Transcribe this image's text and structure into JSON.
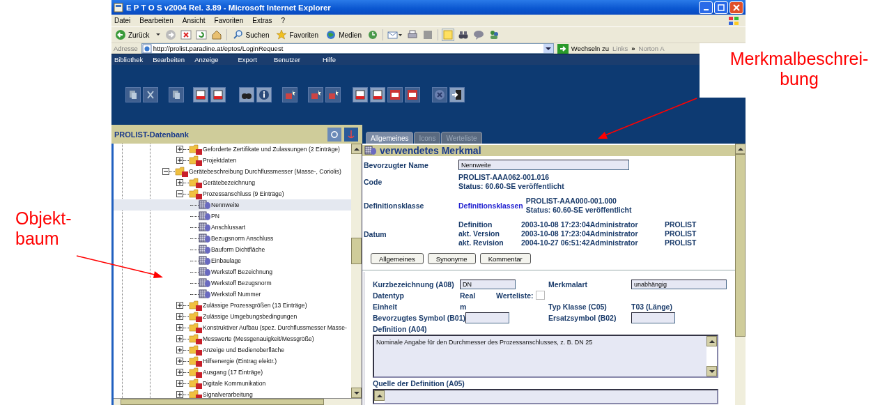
{
  "window": {
    "title": "E P T O S v2004 Rel. 3.89 - Microsoft Internet Explorer"
  },
  "menu": [
    "Datei",
    "Bearbeiten",
    "Ansicht",
    "Favoriten",
    "Extras",
    "?"
  ],
  "toolbar": {
    "back": "Zurück",
    "search": "Suchen",
    "favorites": "Favoriten",
    "media": "Medien"
  },
  "address": {
    "label": "Adresse",
    "url": "http://prolist.paradine.at/eptos/LoginRequest",
    "go": "Wechseln zu",
    "links": "Links",
    "chevron": "»",
    "extra": "Norton A"
  },
  "app_menu": [
    "Bibliothek",
    "Bearbeiten",
    "Anzeige",
    "Export",
    "Benutzer",
    "Hilfe"
  ],
  "tree_panel": {
    "title": "PROLIST-Datenbank"
  },
  "tree": [
    {
      "children": [
        {
          "kind": "folder",
          "label": "Geforderte Zertifikate und Zulassungen (2 Einträge)",
          "expanded": false,
          "selected": false
        },
        {
          "kind": "folder",
          "label": "Projektdaten",
          "expanded": false,
          "selected": false
        }
      ]
    },
    {
      "kind": "folder",
      "label": "Gerätebeschreibung Durchflussmesser (Masse-, Coriolis)",
      "expanded": true,
      "selected": false,
      "children": [
        {
          "kind": "folder",
          "label": "Gerätebezeichnung",
          "expanded": false,
          "selected": false
        },
        {
          "kind": "folder",
          "label": "Prozessanschluss (9 Einträge)",
          "expanded": true,
          "selected": false,
          "children": [
            {
              "kind": "feature",
              "label": "Nennweite",
              "selected": true
            },
            {
              "kind": "feature",
              "label": "PN",
              "selected": false
            },
            {
              "kind": "feature",
              "label": "Anschlussart",
              "selected": false
            },
            {
              "kind": "feature",
              "label": "Bezugsnorm Anschluss",
              "selected": false
            },
            {
              "kind": "feature",
              "label": "Bauform Dichtfläche",
              "selected": false
            },
            {
              "kind": "feature",
              "label": "Einbaulage",
              "selected": false
            },
            {
              "kind": "feature",
              "label": "Werkstoff Bezeichnung",
              "selected": false
            },
            {
              "kind": "feature",
              "label": "Werkstoff Bezugsnorm",
              "selected": false
            },
            {
              "kind": "feature",
              "label": "Werkstoff Nummer",
              "selected": false
            }
          ]
        },
        {
          "kind": "folder",
          "label": "Zulässige Prozessgrößen (13 Einträge)",
          "expanded": false,
          "selected": false
        },
        {
          "kind": "folder",
          "label": "Zulässige Umgebungsbedingungen",
          "expanded": false,
          "selected": false
        },
        {
          "kind": "folder",
          "label": "Konstruktiver Aufbau (spez. Durchflussmesser Masse-",
          "expanded": false,
          "selected": false
        },
        {
          "kind": "folder",
          "label": "Messwerte (Messgenauigkeit/Messgröße)",
          "expanded": false,
          "selected": false
        },
        {
          "kind": "folder",
          "label": "Anzeige und Bedienoberfläche",
          "expanded": false,
          "selected": false
        },
        {
          "kind": "folder",
          "label": "Hilfsenergie (Eintrag elektr.)",
          "expanded": false,
          "selected": false
        },
        {
          "kind": "folder",
          "label": "Ausgang (17 Einträge)",
          "expanded": false,
          "selected": false
        },
        {
          "kind": "folder",
          "label": "Digitale Kommunikation",
          "expanded": false,
          "selected": false
        },
        {
          "kind": "folder",
          "label": "Signalverarbeitung",
          "expanded": false,
          "selected": false
        }
      ]
    }
  ],
  "tabs": [
    {
      "label": "Allgemeines",
      "selected": true
    },
    {
      "label": "Icons",
      "selected": false
    },
    {
      "label": "Werteliste",
      "selected": false
    }
  ],
  "feature": {
    "title": "verwendetes Merkmal",
    "preferred_name": {
      "label": "Bevorzugter Name",
      "value": "Nennweite"
    },
    "code": {
      "label": "Code",
      "lines": [
        "PROLIST-AAA062-001.016",
        "Status: 60.60-SE veröffentlicht"
      ]
    },
    "definition_class": {
      "label": "Definitionsklasse",
      "link": "Definitionsklassen",
      "lines": [
        "PROLIST-AAA000-001.000",
        "Status: 60.60-SE veröffentlicht"
      ]
    },
    "dates": {
      "label": "Datum",
      "rows": [
        {
          "name": "Definition",
          "stamp": "2003-10-08 17:23:04Administrator",
          "org": "PROLIST"
        },
        {
          "name": "akt. Version",
          "stamp": "2003-10-08 17:23:04Administrator",
          "org": "PROLIST"
        },
        {
          "name": "akt. Revision",
          "stamp": "2004-10-27 06:51:42Administrator",
          "org": "PROLIST"
        }
      ]
    },
    "buttons": [
      "Allgemeines",
      "Synonyme",
      "Kommentar"
    ]
  },
  "details": {
    "short_name": {
      "label": "Kurzbezeichnung (A08)",
      "value": "DN"
    },
    "feature_type": {
      "label": "Merkmalart",
      "value": "unabhängig"
    },
    "data_type": {
      "label": "Datentyp",
      "value": "Real"
    },
    "value_list": {
      "label": "Werteliste:",
      "checked": false
    },
    "unit": {
      "label": "Einheit",
      "value": "m"
    },
    "type_class": {
      "label": "Typ Klasse (C05)",
      "value": "T03 (Länge)"
    },
    "preferred_symbol": {
      "label": "Bevorzugtes Symbol (B01)"
    },
    "alt_symbol": {
      "label": "Ersatzsymbol (B02)"
    },
    "definition": {
      "label": "Definition (A04)",
      "value": "Nominale Angabe für den Durchmesser des Prozessanschlusses, z. B. DN 25"
    },
    "source": {
      "label": "Quelle der Definition (A05)"
    }
  },
  "annotations": [
    {
      "lines": [
        "Objekt-",
        "baum"
      ]
    },
    {
      "lines": [
        "Merkmalbeschrei-",
        "bung"
      ]
    }
  ]
}
